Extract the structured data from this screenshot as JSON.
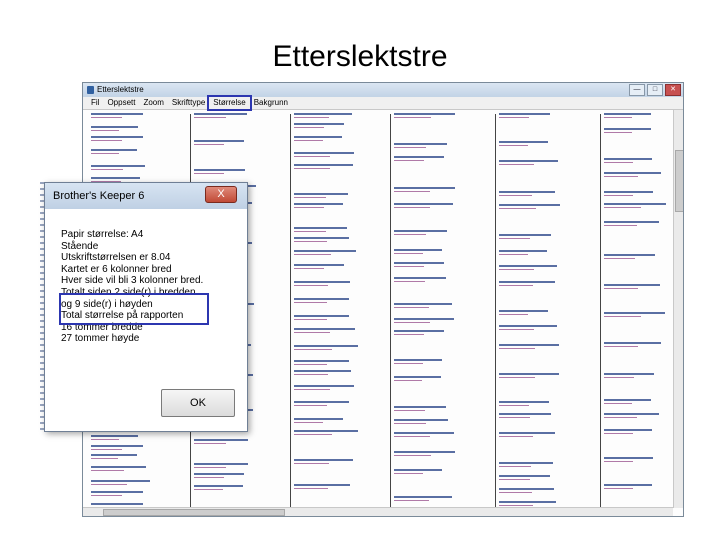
{
  "slide": {
    "title": "Etterslektstre"
  },
  "window": {
    "title": "Etterslektstre",
    "icon": "app-icon",
    "controls": [
      "—",
      "□",
      "✕"
    ]
  },
  "menu": {
    "items": [
      "Fil",
      "Oppsett",
      "Zoom",
      "Skrifttype",
      "Størrelse",
      "Bakgrunn"
    ],
    "highlighted": "Størrelse"
  },
  "dialog": {
    "title": "Brother's Keeper 6",
    "close": "X",
    "lines": [
      "Papir størrelse: A4",
      "Stående",
      "Utskriftstørrelsen er 8.04",
      "Kartet er 6 kolonner bred",
      "Hver side vil bli 3 kolonner bred.",
      "Totalt siden 2 side(r) i bredden",
      "og 9 side(r) i høyden",
      "Total størrelse på rapporten",
      "16 tommer bredde",
      "27 tommer høyde"
    ],
    "ok": "OK"
  },
  "colors": {
    "highlight": "#2c36b0",
    "name_line": "#5a6fa3",
    "spouse_line": "#b07aa8"
  }
}
